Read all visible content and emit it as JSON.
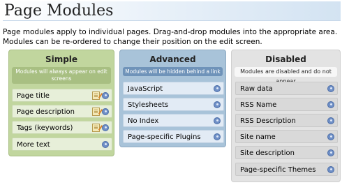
{
  "page": {
    "title": "Page Modules",
    "intro": "Page modules apply to individual pages. Drag-and-drop modules into the appropriate area. Modules can be re-ordered to change their position on the edit screen."
  },
  "columns": {
    "simple": {
      "title": "Simple",
      "description": "Modules will always appear on edit screens",
      "modules": [
        {
          "label": "Page title",
          "icons": [
            "edit-icon",
            "help-icon"
          ]
        },
        {
          "label": "Page description",
          "icons": [
            "edit-icon",
            "help-icon"
          ]
        },
        {
          "label": "Tags (keywords)",
          "icons": [
            "edit-icon",
            "help-icon"
          ]
        },
        {
          "label": "More text",
          "icons": [
            "help-icon"
          ]
        }
      ]
    },
    "advanced": {
      "title": "Advanced",
      "description": "Modules will be hidden behind a link",
      "modules": [
        {
          "label": "JavaScript",
          "icons": [
            "help-icon"
          ]
        },
        {
          "label": "Stylesheets",
          "icons": [
            "help-icon"
          ]
        },
        {
          "label": "No Index",
          "icons": [
            "help-icon"
          ]
        },
        {
          "label": "Page-specific Plugins",
          "icons": [
            "help-icon"
          ]
        }
      ]
    },
    "disabled": {
      "title": "Disabled",
      "description": "Modules are disabled and do not appear",
      "modules": [
        {
          "label": "Raw data",
          "icons": [
            "help-icon"
          ]
        },
        {
          "label": "RSS Name",
          "icons": [
            "help-icon"
          ]
        },
        {
          "label": "RSS Description",
          "icons": [
            "help-icon"
          ]
        },
        {
          "label": "Site name",
          "icons": [
            "help-icon"
          ]
        },
        {
          "label": "Site description",
          "icons": [
            "help-icon"
          ]
        },
        {
          "label": "Page-specific Themes",
          "icons": [
            "help-icon"
          ]
        }
      ]
    }
  },
  "colors": {
    "simple_bg": "#c1d69e",
    "advanced_bg": "#a8c3d9",
    "disabled_bg": "#e3e3e3"
  }
}
